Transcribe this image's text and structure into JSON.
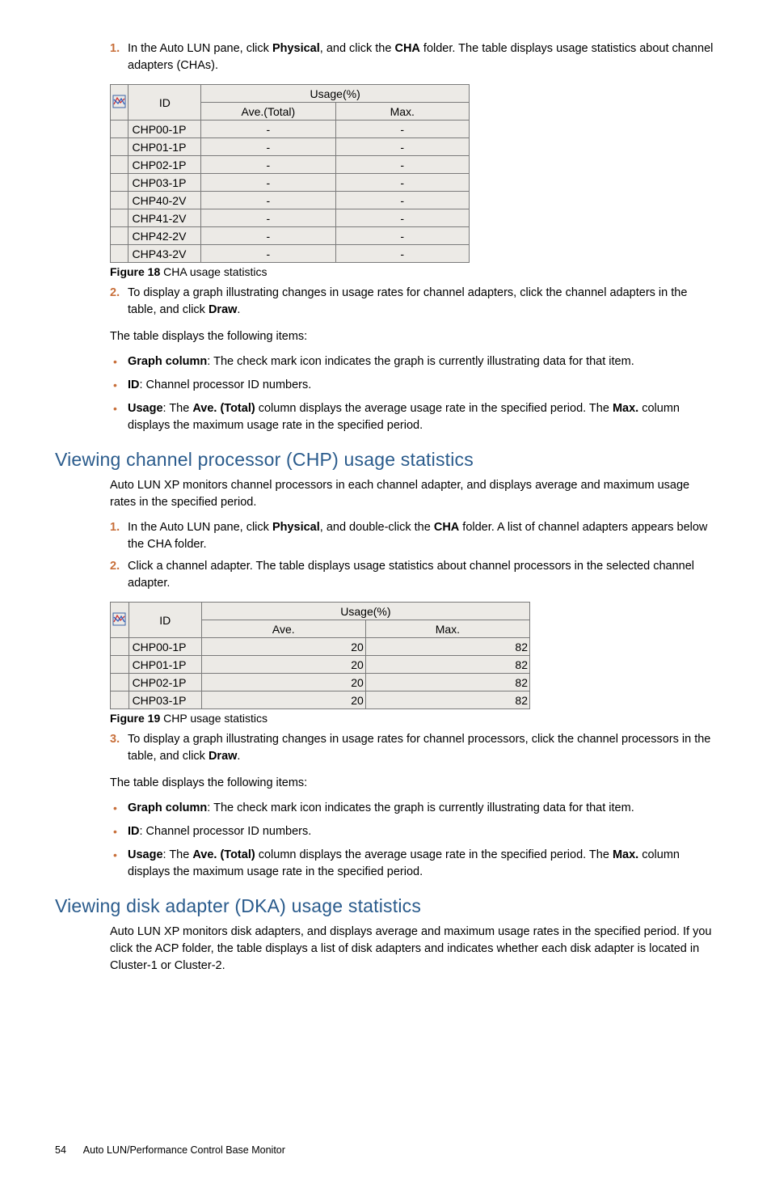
{
  "step1": {
    "num": "1.",
    "pre": "In the Auto LUN pane, click ",
    "b1": "Physical",
    "mid": ", and click the ",
    "b2": "CHA",
    "post": " folder. The table displays usage statistics about channel adapters (CHAs)."
  },
  "table1": {
    "h_id": "ID",
    "h_usage": "Usage(%)",
    "h_ave": "Ave.(Total)",
    "h_max": "Max.",
    "rows": [
      {
        "id": "CHP00-1P",
        "ave": "-",
        "max": "-"
      },
      {
        "id": "CHP01-1P",
        "ave": "-",
        "max": "-"
      },
      {
        "id": "CHP02-1P",
        "ave": "-",
        "max": "-"
      },
      {
        "id": "CHP03-1P",
        "ave": "-",
        "max": "-"
      },
      {
        "id": "CHP40-2V",
        "ave": "-",
        "max": "-"
      },
      {
        "id": "CHP41-2V",
        "ave": "-",
        "max": "-"
      },
      {
        "id": "CHP42-2V",
        "ave": "-",
        "max": "-"
      },
      {
        "id": "CHP43-2V",
        "ave": "-",
        "max": "-"
      }
    ]
  },
  "fig18": {
    "label": "Figure 18",
    "text": "  CHA usage statistics"
  },
  "step2a": {
    "num": "2.",
    "pre": "To display a graph illustrating changes in usage rates for channel adapters, click the channel adapters in the table, and click ",
    "b1": "Draw",
    "post": "."
  },
  "para_items_intro": "The table displays the following items:",
  "bullets1": {
    "b1_label": "Graph column",
    "b1_text": ": The check mark icon indicates the graph is currently illustrating data for that item.",
    "b2_label": "ID",
    "b2_text": ": Channel processor ID numbers.",
    "b3_label": "Usage",
    "b3_pre": ": The ",
    "b3_b1": "Ave. (Total)",
    "b3_mid": " column displays the average usage rate in the specified period. The ",
    "b3_b2": "Max.",
    "b3_post": " column displays the maximum usage rate in the specified period."
  },
  "heading_chp": "Viewing channel processor (CHP) usage statistics",
  "para_chp_intro": "Auto LUN XP monitors channel processors in each channel adapter, and displays average and maximum usage rates in the specified period.",
  "chp_step1": {
    "num": "1.",
    "pre": "In the Auto LUN pane, click ",
    "b1": "Physical",
    "mid": ", and double-click the ",
    "b2": "CHA",
    "post": " folder. A list of channel adapters appears below the CHA folder."
  },
  "chp_step2": {
    "num": "2.",
    "text": "Click a channel adapter. The table displays usage statistics about channel processors in the selected channel adapter."
  },
  "table2": {
    "h_id": "ID",
    "h_usage": "Usage(%)",
    "h_ave": "Ave.",
    "h_max": "Max.",
    "rows": [
      {
        "id": "CHP00-1P",
        "ave": "20",
        "max": "82"
      },
      {
        "id": "CHP01-1P",
        "ave": "20",
        "max": "82"
      },
      {
        "id": "CHP02-1P",
        "ave": "20",
        "max": "82"
      },
      {
        "id": "CHP03-1P",
        "ave": "20",
        "max": "82"
      }
    ]
  },
  "fig19": {
    "label": "Figure 19",
    "text": "  CHP usage statistics"
  },
  "chp_step3": {
    "num": "3.",
    "pre": "To display a graph illustrating changes in usage rates for channel processors, click the channel processors in the table, and click ",
    "b1": "Draw",
    "post": "."
  },
  "heading_dka": "Viewing disk adapter (DKA) usage statistics",
  "para_dka_intro": "Auto LUN XP monitors disk adapters, and displays average and maximum usage rates in the specified period. If you click the ACP folder, the table displays a list of disk adapters and indicates whether each disk adapter is located in Cluster-1 or Cluster-2.",
  "footer": {
    "page": "54",
    "title": "Auto LUN/Performance Control Base Monitor"
  }
}
